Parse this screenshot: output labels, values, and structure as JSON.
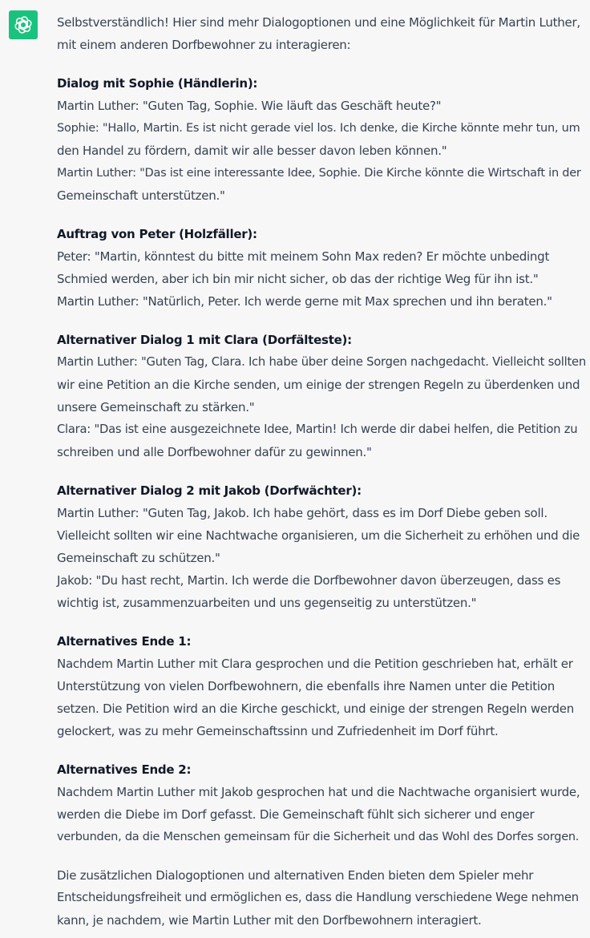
{
  "assistant": {
    "avatar_icon": "openai-logo-icon",
    "avatar_color": "#19c37d"
  },
  "message": {
    "intro": [
      "Selbstverständlich! Hier sind mehr Dialogoptionen und eine Möglichkeit für Martin Luther,",
      "mit einem anderen Dorfbewohner zu interagieren:"
    ],
    "sections": [
      {
        "heading": "Dialog mit Sophie (Händlerin):",
        "lines": [
          "Martin Luther: \"Guten Tag, Sophie. Wie läuft das Geschäft heute?\"",
          "Sophie: \"Hallo, Martin. Es ist nicht gerade viel los. Ich denke, die Kirche könnte mehr tun, um",
          "den Handel zu fördern, damit wir alle besser davon leben können.\"",
          "Martin Luther: \"Das ist eine interessante Idee, Sophie. Die Kirche könnte die Wirtschaft in der",
          "Gemeinschaft unterstützen.\""
        ]
      },
      {
        "heading": "Auftrag von Peter (Holzfäller):",
        "lines": [
          "Peter: \"Martin, könntest du bitte mit meinem Sohn Max reden? Er möchte unbedingt",
          "Schmied werden, aber ich bin mir nicht sicher, ob das der richtige Weg für ihn ist.\"",
          "Martin Luther: \"Natürlich, Peter. Ich werde gerne mit Max sprechen und ihn beraten.\""
        ]
      },
      {
        "heading": "Alternativer Dialog 1 mit Clara (Dorfälteste):",
        "lines": [
          "Martin Luther: \"Guten Tag, Clara. Ich habe über deine Sorgen nachgedacht. Vielleicht sollten",
          "wir eine Petition an die Kirche senden, um einige der strengen Regeln zu überdenken und",
          "unsere Gemeinschaft zu stärken.\"",
          "Clara: \"Das ist eine ausgezeichnete Idee, Martin! Ich werde dir dabei helfen, die Petition zu",
          "schreiben und alle Dorfbewohner dafür zu gewinnen.\""
        ]
      },
      {
        "heading": "Alternativer Dialog 2 mit Jakob (Dorfwächter):",
        "lines": [
          "Martin Luther: \"Guten Tag, Jakob. Ich habe gehört, dass es im Dorf Diebe geben soll.",
          "Vielleicht sollten wir eine Nachtwache organisieren, um die Sicherheit zu erhöhen und die",
          "Gemeinschaft zu schützen.\"",
          "Jakob: \"Du hast recht, Martin. Ich werde die Dorfbewohner davon überzeugen, dass es",
          "wichtig ist, zusammenzuarbeiten und uns gegenseitig zu unterstützen.\""
        ]
      },
      {
        "heading": "Alternatives Ende 1:",
        "lines": [
          "Nachdem Martin Luther mit Clara gesprochen und die Petition geschrieben hat, erhält er",
          "Unterstützung von vielen Dorfbewohnern, die ebenfalls ihre Namen unter die Petition",
          "setzen. Die Petition wird an die Kirche geschickt, und einige der strengen Regeln werden",
          "gelockert, was zu mehr Gemeinschaftssinn und Zufriedenheit im Dorf führt."
        ]
      },
      {
        "heading": "Alternatives Ende 2:",
        "lines": [
          "Nachdem Martin Luther mit Jakob gesprochen hat und die Nachtwache organisiert wurde,",
          "werden die Diebe im Dorf gefasst. Die Gemeinschaft fühlt sich sicherer und enger",
          "verbunden, da die Menschen gemeinsam für die Sicherheit und das Wohl des Dorfes sorgen."
        ]
      }
    ],
    "outro": [
      "Die zusätzlichen Dialogoptionen und alternativen Enden bieten dem Spieler mehr",
      "Entscheidungsfreiheit und ermöglichen es, dass die Handlung verschiedene Wege nehmen",
      "kann, je nachdem, wie Martin Luther mit den Dorfbewohnern interagiert."
    ]
  }
}
